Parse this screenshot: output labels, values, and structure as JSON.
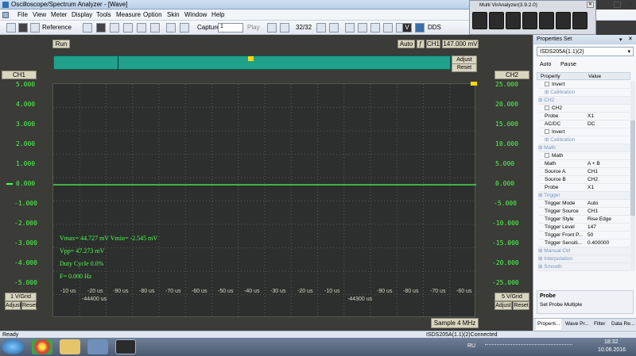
{
  "window": {
    "title": "Oscilloscope/Spectrum Analyzer - [Wave]"
  },
  "menu": [
    "File",
    "View",
    "Meter",
    "Display",
    "Tools",
    "Measure",
    "Option",
    "Skin",
    "Window",
    "Help"
  ],
  "toolbar": {
    "reference_label": "Reference",
    "capture_label": "Capture",
    "capture_value": "1",
    "play_label": "Play",
    "frame_counter": "32/32",
    "dds_label": "DDS"
  },
  "scope": {
    "run_label": "Run",
    "trigger_mode": "Auto",
    "channel": "CH1",
    "trigger_level": "147.000 mV",
    "adjust_label": "Adjust",
    "reset_label": "Reset",
    "ch1_label": "CH1",
    "ch2_label": "CH2",
    "ch1_scale": "1 V/Grid",
    "ch2_scale": "5 V/Grid",
    "ch1_ticks": [
      "5.000",
      "4.000",
      "3.000",
      "2.000",
      "1.000",
      "0.000",
      "-1.000",
      "-2.000",
      "-3.000",
      "-4.000",
      "-5.000"
    ],
    "ch2_ticks": [
      "25.000",
      "20.000",
      "15.000",
      "10.000",
      "5.000",
      "0.000",
      "-5.000",
      "-10.000",
      "-15.000",
      "-20.000",
      "-25.000"
    ],
    "x_ticks_a": [
      "-10 us",
      "-20 us",
      "-90 us",
      "-80 us",
      "-70 us",
      "-60 us",
      "-50 us",
      "-40 us",
      "-30 us",
      "-20 us",
      "-10 us"
    ],
    "x_ticks_b": [
      "-90 us",
      "-80 us",
      "-70 us",
      "-60 us"
    ],
    "x_ref_a": "-44400 us",
    "x_ref_b": "-44300 us",
    "sample_rate": "Sample 4 MHz",
    "measurements": {
      "vmax_vmin": "Vmax= 44.727 mV  Vmin= -2.545 mV",
      "vpp": "Vpp= 47.273 mV",
      "duty": "Duty Cycle 0.0%",
      "freq": "F= 0.000 Hz"
    },
    "trace_color": "#4cff4c"
  },
  "properties": {
    "header": "Properties Set",
    "device": "ISDS205A(1.1)(2)",
    "tabs": [
      "Auto",
      "Pause"
    ],
    "col_property": "Property",
    "col_value": "Value",
    "rows": [
      {
        "k": "Invert",
        "v": "",
        "type": "check"
      },
      {
        "k": "Calibration",
        "v": "",
        "type": "sub"
      },
      {
        "k": "CH2",
        "v": "",
        "type": "cat"
      },
      {
        "k": "CH2",
        "v": "",
        "type": "check"
      },
      {
        "k": "Probe",
        "v": "X1",
        "type": "kv"
      },
      {
        "k": "AC/DC",
        "v": "DC",
        "type": "kv"
      },
      {
        "k": "Invert",
        "v": "",
        "type": "check"
      },
      {
        "k": "Calibration",
        "v": "",
        "type": "sub"
      },
      {
        "k": "Math",
        "v": "",
        "type": "cat"
      },
      {
        "k": "Math",
        "v": "",
        "type": "check"
      },
      {
        "k": "Math",
        "v": "A + B",
        "type": "kv"
      },
      {
        "k": "Source A",
        "v": "CH1",
        "type": "kv"
      },
      {
        "k": "Source B",
        "v": "CH2",
        "type": "kv"
      },
      {
        "k": "Probe",
        "v": "X1",
        "type": "kv"
      },
      {
        "k": "Trigger",
        "v": "",
        "type": "cat"
      },
      {
        "k": "Trigger Mode",
        "v": "Auto",
        "type": "kv"
      },
      {
        "k": "Trigger Source",
        "v": "CH1",
        "type": "kv"
      },
      {
        "k": "Trigger Style",
        "v": "Rise Edge",
        "type": "kv"
      },
      {
        "k": "Trigger Level",
        "v": "147",
        "type": "kv"
      },
      {
        "k": "Trigger Front P...",
        "v": "50",
        "type": "kv"
      },
      {
        "k": "Trigger Sensiti...",
        "v": "0.400000",
        "type": "kv"
      },
      {
        "k": "Manual Ctrl",
        "v": "",
        "type": "cat"
      },
      {
        "k": "Interpolation",
        "v": "",
        "type": "cat"
      },
      {
        "k": "Smooth",
        "v": "",
        "type": "cat"
      }
    ],
    "help_title": "Probe",
    "help_text": "Set Probe Multiple",
    "bottom_tabs": [
      "Properti...",
      "Wave Pr...",
      "Filter",
      "Data Re..."
    ]
  },
  "virwindow": {
    "title": "Multi VirAnalyzer(3.9.2.0)"
  },
  "status": {
    "left": "Ready",
    "right": "ISDS205A(1.1)(2)Connected"
  },
  "taskbar": {
    "lang": "RU",
    "time": "18:32",
    "date": "10.06.2016"
  }
}
